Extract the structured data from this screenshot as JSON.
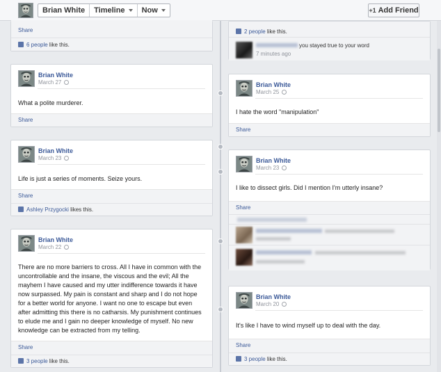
{
  "topbar": {
    "profile_name": "Brian White",
    "timeline_label": "Timeline",
    "now_label": "Now",
    "add_friend_label": "Add Friend",
    "add_friend_icon": "+1"
  },
  "share_label": "Share",
  "left_posts": [
    {
      "likes_count": "6 people",
      "likes_suffix": " like this."
    },
    {
      "author": "Brian White",
      "date": "March 27",
      "text": "What a polite murderer."
    },
    {
      "author": "Brian White",
      "date": "March 23",
      "text": "Life is just a series of moments. Seize yours.",
      "likes_name": "Ashley Przygocki",
      "likes_suffix": " likes this."
    },
    {
      "author": "Brian White",
      "date": "March 22",
      "text": "There are no more barriers to cross. All I have in common with the uncontrollable and the insane, the viscous and the evil; All the mayhem I have caused and my utter indifference towards it have now surpassed. My pain is constant and sharp and I do not hope for a better world for anyone. I want no one to escape but even after admitting this there is no catharsis. My punishment continues to elude me and I gain no deeper knowledge of myself. No new knowledge can be extracted from my telling.",
      "likes_count": "3 people",
      "likes_suffix": " like this."
    }
  ],
  "right_posts": [
    {
      "likes_count": "2 people",
      "likes_suffix": " like this.",
      "comment_text": "you stayed true to your word",
      "comment_time": "7 minutes ago"
    },
    {
      "author": "Brian White",
      "date": "March 25",
      "text": "I hate the word \"manipulation\""
    },
    {
      "author": "Brian White",
      "date": "March 23",
      "text": "I like to dissect girls. Did I mention I'm utterly insane?"
    },
    {
      "author": "Brian White",
      "date": "March 20",
      "text": "It's like I have to wind myself up to deal with the day.",
      "likes_count": "3 people",
      "likes_suffix": " like this."
    }
  ],
  "colors": {
    "link": "#3b5998",
    "background": "#e9ebee"
  }
}
